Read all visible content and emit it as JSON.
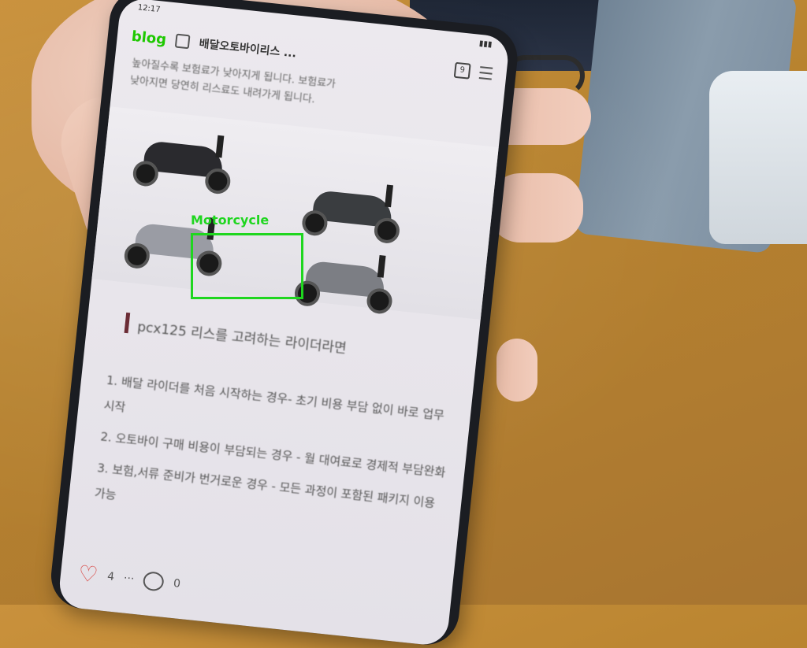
{
  "status": {
    "time": "12:17"
  },
  "appbar": {
    "logo": "blog",
    "title": "배달오토바이리스 ...",
    "tab_count": "9"
  },
  "intro": {
    "line1": "높아질수록 보험료가 낮아지게 됩니다. 보험료가",
    "line2": "낮아지면 당연히 리스료도 내려가게 됩니다."
  },
  "heading": "pcx125 리스를 고려하는 라이더라면",
  "list": [
    "1. 배달 라이더를 처음 시작하는 경우- 초기 비용 부담 없이 바로 업무시작",
    "2. 오토바이 구매 비용이 부담되는 경우 - 월 대여료로 경제적 부담완화",
    "3. 보험,서류 준비가 번거로운 경우 - 모든 과정이 포함된 패키지 이용 가능"
  ],
  "bottom": {
    "likes": "4",
    "more": "···",
    "comments": "0"
  },
  "detection": {
    "label": "Motorcycle",
    "color": "#1fd61f"
  },
  "colors": {
    "accent": "#1ec800",
    "heading_bar": "#6b2c35"
  }
}
